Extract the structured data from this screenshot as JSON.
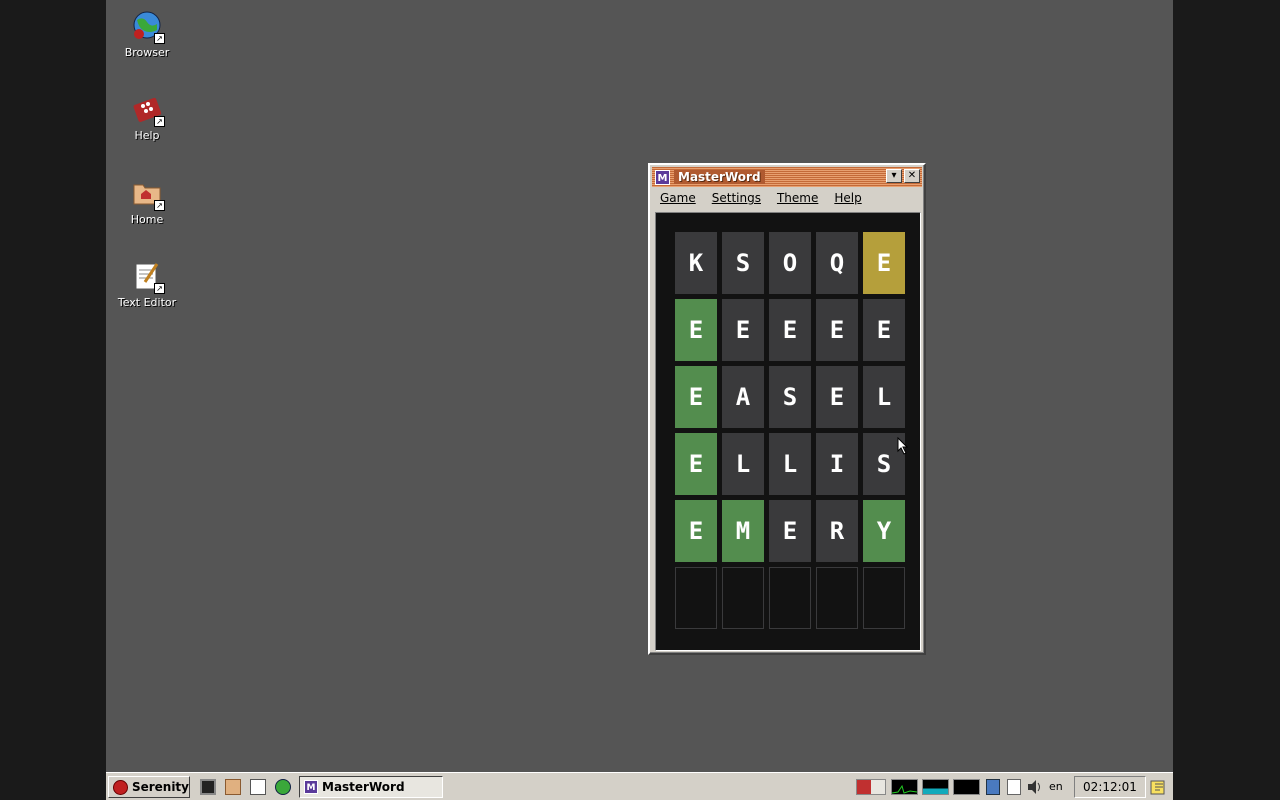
{
  "desktop": {
    "icons": [
      {
        "label": "Browser",
        "icon": "globe-icon"
      },
      {
        "label": "Help",
        "icon": "help-book-icon"
      },
      {
        "label": "Home",
        "icon": "home-folder-icon"
      },
      {
        "label": "Text Editor",
        "icon": "text-editor-icon"
      }
    ]
  },
  "window": {
    "title": "MasterWord",
    "icon_letter": "M",
    "menu": [
      "Game",
      "Settings",
      "Theme",
      "Help"
    ],
    "board": {
      "rows": [
        [
          {
            "l": "K",
            "s": "absent"
          },
          {
            "l": "S",
            "s": "absent"
          },
          {
            "l": "O",
            "s": "absent"
          },
          {
            "l": "Q",
            "s": "absent"
          },
          {
            "l": "E",
            "s": "present"
          }
        ],
        [
          {
            "l": "E",
            "s": "correct"
          },
          {
            "l": "E",
            "s": "absent"
          },
          {
            "l": "E",
            "s": "absent"
          },
          {
            "l": "E",
            "s": "absent"
          },
          {
            "l": "E",
            "s": "absent"
          }
        ],
        [
          {
            "l": "E",
            "s": "correct"
          },
          {
            "l": "A",
            "s": "absent"
          },
          {
            "l": "S",
            "s": "absent"
          },
          {
            "l": "E",
            "s": "absent"
          },
          {
            "l": "L",
            "s": "absent"
          }
        ],
        [
          {
            "l": "E",
            "s": "correct"
          },
          {
            "l": "L",
            "s": "absent"
          },
          {
            "l": "L",
            "s": "absent"
          },
          {
            "l": "I",
            "s": "absent"
          },
          {
            "l": "S",
            "s": "absent"
          }
        ],
        [
          {
            "l": "E",
            "s": "correct"
          },
          {
            "l": "M",
            "s": "correct"
          },
          {
            "l": "E",
            "s": "absent"
          },
          {
            "l": "R",
            "s": "absent"
          },
          {
            "l": "Y",
            "s": "correct"
          }
        ],
        [
          {
            "l": "",
            "s": "empty"
          },
          {
            "l": "",
            "s": "empty"
          },
          {
            "l": "",
            "s": "empty"
          },
          {
            "l": "",
            "s": "empty"
          },
          {
            "l": "",
            "s": "empty"
          }
        ]
      ]
    },
    "colors": {
      "correct": "#538d4e",
      "present": "#b59f3b",
      "absent": "#3a3a3c",
      "background": "#121212"
    }
  },
  "taskbar": {
    "start_label": "Serenity",
    "task_label": "MasterWord",
    "keyboard_layout": "en",
    "clock": "02:12:01"
  }
}
